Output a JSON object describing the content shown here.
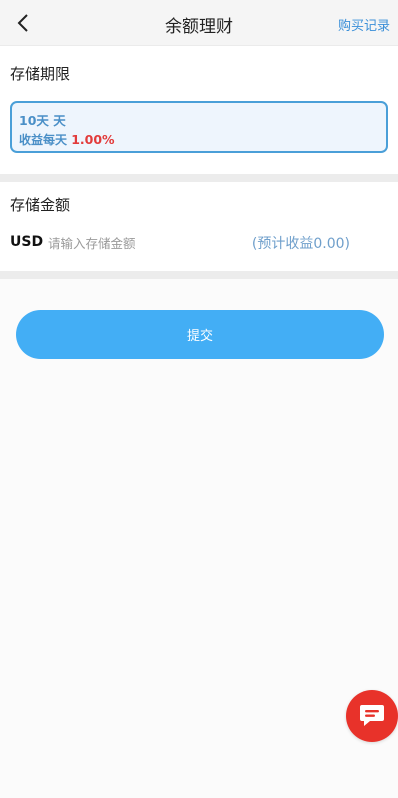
{
  "header": {
    "title": "余额理财",
    "record_link": "购买记录"
  },
  "period_section": {
    "label": "存储期限",
    "options": [
      {
        "days_label": "10天 天",
        "rate_prefix": "收益每天",
        "rate_value": "1.00%"
      }
    ]
  },
  "amount_section": {
    "label": "存储金额",
    "currency": "USD",
    "placeholder": "请输入存储金额",
    "value": "",
    "expected_income": "(预计收益0.00)"
  },
  "submit": {
    "label": "提交"
  },
  "colors": {
    "accent": "#43aef5",
    "link": "#3a8fd8",
    "rate": "#e23b3b",
    "chat": "#e8322a"
  },
  "icons": {
    "back": "chevron-left-icon",
    "chat": "chat-icon"
  }
}
